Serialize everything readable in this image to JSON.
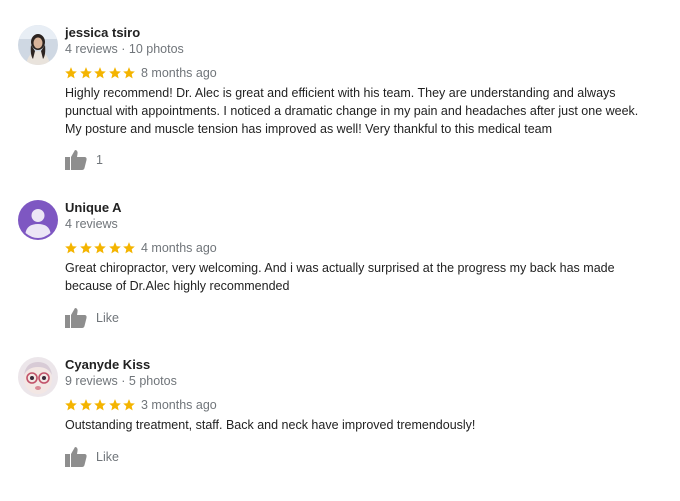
{
  "reviews": [
    {
      "name": "jessica tsiro",
      "meta": "4 reviews · 10 photos",
      "rating": 5,
      "time": "8 months ago",
      "text_lines": [
        "Highly recommend! Dr. Alec is great and efficient with his team. They are understanding and always",
        "punctual with appointments. I noticed a dramatic change in my pain and headaches after just one week.",
        "My posture and muscle tension has improved as well! Very thankful to this medical team"
      ],
      "like_label": "1"
    },
    {
      "name": "Unique A",
      "meta": "4 reviews",
      "rating": 5,
      "time": "4 months ago",
      "text_lines": [
        "Great chiropractor, very welcoming. And i was actually surprised at the progress my back has made",
        "because of Dr.Alec highly recommended"
      ],
      "like_label": "Like"
    },
    {
      "name": "Cyanyde Kiss",
      "meta": "9 reviews · 5 photos",
      "rating": 5,
      "time": "3 months ago",
      "text_lines": [
        "Outstanding treatment, staff. Back and neck have improved tremendously!"
      ],
      "like_label": "Like"
    }
  ],
  "colors": {
    "star": "#f4b400",
    "muted": "#70757a",
    "text": "#222222",
    "avatar_purple": "#7e57c2"
  },
  "icons": {
    "star": "star-icon",
    "like": "thumbs-up-icon",
    "avatar_placeholder": "person-icon"
  }
}
